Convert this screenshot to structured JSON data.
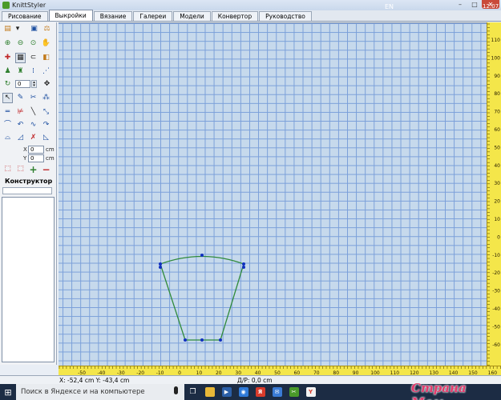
{
  "window": {
    "title": "KnittStyler",
    "minimize": "–",
    "maximize": "□",
    "close": "✕"
  },
  "tabs": [
    {
      "label": "Рисование",
      "active": false
    },
    {
      "label": "Выкройки",
      "active": true
    },
    {
      "label": "Вязание",
      "active": false
    },
    {
      "label": "Галереи",
      "active": false
    },
    {
      "label": "Модели",
      "active": false
    },
    {
      "label": "Конвертор",
      "active": false
    },
    {
      "label": "Руководство",
      "active": false
    }
  ],
  "sidebar": {
    "rotate_value": "0",
    "x_label": "X",
    "x_value": "0",
    "x_unit": "cm",
    "y_label": "Y",
    "y_value": "0",
    "y_unit": "cm",
    "section_title": "Конструктор",
    "toolbar_icons": [
      "folder-icon",
      "save-icon",
      "measure-icon",
      "zoom-in-icon",
      "zoom-out-icon",
      "zoom-fit-icon",
      "hand-icon",
      "cross-icon",
      "grid-icon",
      "link-icon",
      "fill-icon",
      "figure-icon",
      "figure-alt-icon",
      "points-icon",
      "node-icon",
      "rotate-icon",
      "move-icon",
      "select-icon",
      "pen-icon",
      "scissors-icon",
      "add-point-icon",
      "line-tool-icon",
      "line-x-icon",
      "line-cross-icon",
      "line-diag-icon",
      "curve-icon",
      "curve-left-icon",
      "curve-mid-icon",
      "curve-right-icon",
      "shape-icon",
      "shape-left-icon",
      "shape-cut-icon",
      "shape-right-icon",
      "select-area-icon",
      "select-point-icon",
      "add-icon",
      "remove-icon"
    ]
  },
  "canvas": {
    "line_color": "#2f8a3a",
    "point_color": "#1030c0"
  },
  "rulers": {
    "vertical_labels": [
      "110",
      "100",
      "90",
      "80",
      "70",
      "60",
      "50",
      "40",
      "30",
      "20",
      "10",
      "0",
      "-10",
      "-20",
      "-30",
      "-40",
      "-50",
      "-60"
    ],
    "horizontal_labels": [
      "-50",
      "-40",
      "-30",
      "-20",
      "-10",
      "0",
      "10",
      "20",
      "30",
      "40",
      "50",
      "60",
      "70",
      "80",
      "90",
      "100",
      "110",
      "120",
      "130",
      "140",
      "150",
      "160"
    ]
  },
  "status": {
    "coordinates": "X: -52,4 cm   Y: -43,4 cm",
    "length": "Д/Р: 0,0 cm"
  },
  "taskbar": {
    "search_placeholder": "Поиск в Яндексе и на компьютере",
    "lang": "EN",
    "watermark": "Страна Мам",
    "clock": "12:07"
  }
}
